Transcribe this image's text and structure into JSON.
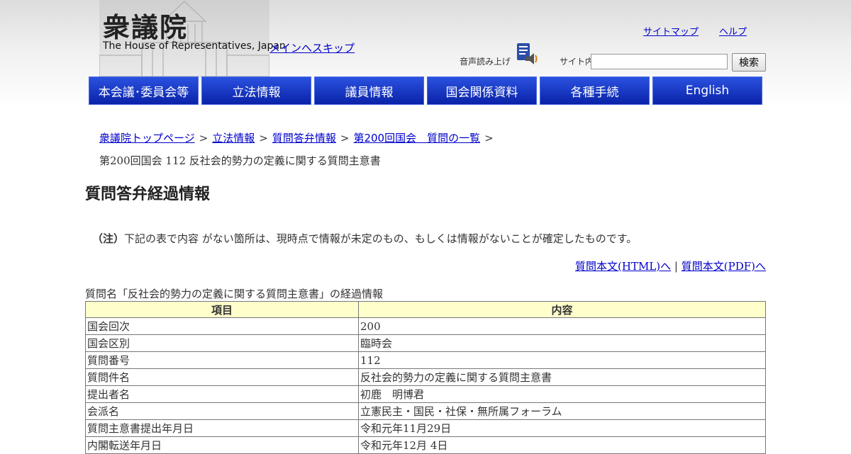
{
  "header": {
    "logo_kanji": "衆議院",
    "logo_english": "The House of Representatives, Japan",
    "skip_link": "メインへスキップ",
    "sitemap_link": "サイトマップ",
    "help_link": "ヘルプ",
    "voice_label": "音声読み上げ",
    "voice_icon": "speaker-icon",
    "search_label": "サイト内検索",
    "search_value": "",
    "search_button": "検索"
  },
  "nav": {
    "items": [
      {
        "label": "本会議･委員会等"
      },
      {
        "label": "立法情報"
      },
      {
        "label": "議員情報"
      },
      {
        "label": "国会関係資料"
      },
      {
        "label": "各種手続"
      },
      {
        "label": "English"
      }
    ]
  },
  "breadcrumb": {
    "items": [
      "衆議院トップページ",
      "立法情報",
      "質問答弁情報",
      "第200回国会　質問の一覧"
    ],
    "separator": ">",
    "current": "第200回国会 112 反社会的勢力の定義に関する質問主意書"
  },
  "page": {
    "title": "質問答弁経過情報",
    "note_label": "（注）",
    "note_text": "下記の表で内容 がない箇所は、現時点で情報が未定のもの、もしくは情報がないことが確定したものです。",
    "link_html": "質問本文(HTML)へ",
    "link_separator": "|",
    "link_pdf": "質問本文(PDF)へ",
    "table_caption": "質問名「反社会的勢力の定義に関する質問主意書」の経過情報"
  },
  "table": {
    "headers": [
      "項目",
      "内容"
    ],
    "rows": [
      [
        "国会回次",
        "200"
      ],
      [
        "国会区別",
        "臨時会"
      ],
      [
        "質問番号",
        "112"
      ],
      [
        "質問件名",
        "反社会的勢力の定義に関する質問主意書"
      ],
      [
        "提出者名",
        "初鹿　明博君"
      ],
      [
        "会派名",
        "立憲民主・国民・社保・無所属フォーラム"
      ],
      [
        "質問主意書提出年月日",
        "令和元年11月29日"
      ],
      [
        "内閣転送年月日",
        "令和元年12月 4日"
      ]
    ]
  },
  "colors": {
    "nav_bg": "#0a22a8",
    "link": "#0000cc",
    "table_header_bg": "#ffffcc"
  }
}
